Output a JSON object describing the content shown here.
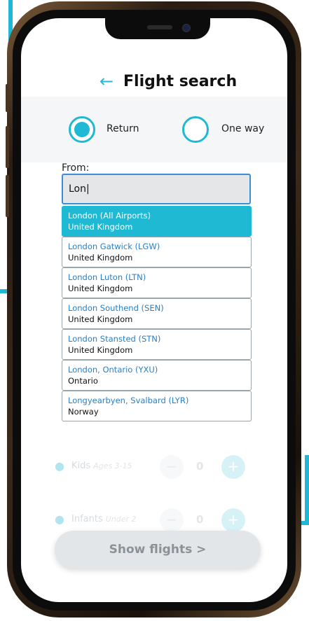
{
  "screen": {
    "title": "Flight search",
    "back_glyph": "←",
    "trip_type": {
      "return_label": "Return",
      "oneway_label": "One way",
      "selected": "Return"
    },
    "from": {
      "label": "From:",
      "value": "Lon|"
    },
    "suggestions": [
      {
        "city": "London (All Airports)",
        "country": "United Kingdom",
        "selected": true
      },
      {
        "city": "London Gatwick (LGW)",
        "country": "United Kingdom"
      },
      {
        "city": "London Luton (LTN)",
        "country": "United Kingdom"
      },
      {
        "city": "London Southend (SEN)",
        "country": "United Kingdom"
      },
      {
        "city": "London Stansted (STN)",
        "country": "United Kingdom"
      },
      {
        "city": "London, Ontario (YXU)",
        "country": "Ontario"
      },
      {
        "city": "Longyearbyen, Svalbard (LYR)",
        "country": "Norway"
      }
    ],
    "passengers": [
      {
        "label": "Kids",
        "sub": "Ages 3-15",
        "count": "0",
        "minus": "−",
        "plus": "+"
      },
      {
        "label": "Infants",
        "sub": "Under 2",
        "count": "0",
        "minus": "−",
        "plus": "+"
      }
    ],
    "show_button": "Show flights >"
  },
  "colors": {
    "accent": "#1fb9d3",
    "link": "#2a7fc4",
    "input_border": "#3a8ed8"
  }
}
